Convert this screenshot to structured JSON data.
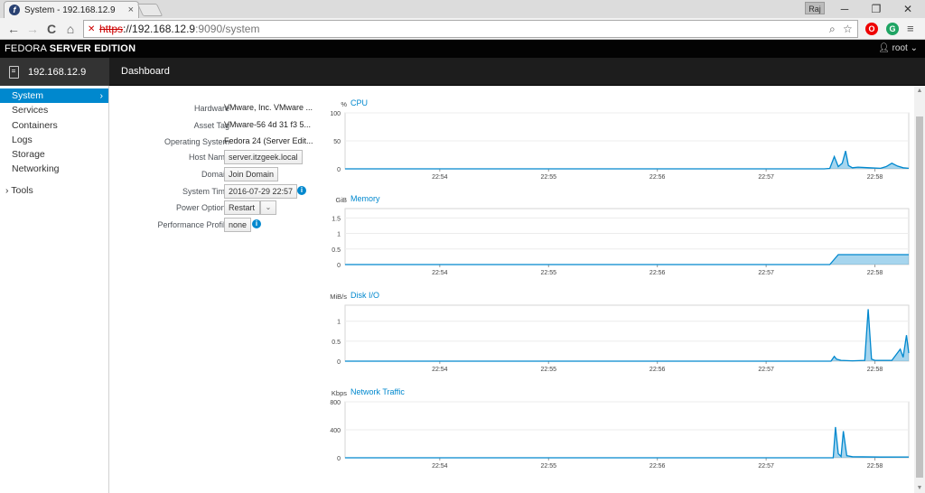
{
  "browser": {
    "tab_title": "System - 192.168.12.9",
    "tab_close": "×",
    "user_badge": "Raj",
    "url_scheme": "https",
    "url_host": "://192.168.12.9",
    "url_path": ":9090/system",
    "window_controls": {
      "minimize": "─",
      "restore": "❐",
      "close": "✕"
    },
    "nav": {
      "back": "←",
      "forward": "→",
      "reload": "C",
      "home": "⌂"
    }
  },
  "header": {
    "brand_light": "FEDORA",
    "brand_bold": "SERVER EDITION",
    "user": "root",
    "host": "192.168.12.9",
    "dashboard": "Dashboard"
  },
  "sidebar": {
    "items": [
      {
        "label": "System",
        "active": true
      },
      {
        "label": "Services"
      },
      {
        "label": "Containers"
      },
      {
        "label": "Logs"
      },
      {
        "label": "Storage"
      },
      {
        "label": "Networking"
      }
    ],
    "tools": "Tools"
  },
  "system_info": {
    "hardware_label": "Hardware",
    "hardware_value": "VMware, Inc. VMware ...",
    "asset_tag_label": "Asset Tag",
    "asset_tag_value": "VMware-56 4d 31 f3 5...",
    "os_label": "Operating System",
    "os_value": "Fedora 24 (Server Edit...",
    "hostname_label": "Host Name",
    "hostname_value": "server.itzgeek.local",
    "domain_label": "Domain",
    "domain_button": "Join Domain",
    "time_label": "System Time",
    "time_value": "2016-07-29 22:57",
    "power_label": "Power Options",
    "power_button": "Restart",
    "profile_label": "Performance Profile",
    "profile_value": "none"
  },
  "chart_data": [
    {
      "type": "area",
      "title": "CPU",
      "ylabel": "%",
      "yticks": [
        "100",
        "50",
        "0"
      ],
      "ylim": [
        0,
        100
      ],
      "x": [
        "22:54",
        "22:55",
        "22:56",
        "22:57",
        "22:58"
      ],
      "series": [
        {
          "points": [
            [
              0,
              0
            ],
            [
              0.85,
              0
            ],
            [
              0.86,
              0.8
            ],
            [
              0.868,
              22
            ],
            [
              0.875,
              4
            ],
            [
              0.882,
              10
            ],
            [
              0.888,
              32
            ],
            [
              0.893,
              6
            ],
            [
              0.9,
              2
            ],
            [
              0.91,
              3
            ],
            [
              0.93,
              2
            ],
            [
              0.95,
              1
            ],
            [
              0.96,
              4
            ],
            [
              0.97,
              10
            ],
            [
              0.98,
              5
            ],
            [
              0.99,
              2
            ],
            [
              1,
              1
            ]
          ]
        }
      ],
      "color": "#0088ce"
    },
    {
      "type": "area",
      "title": "Memory",
      "ylabel": "GiB",
      "yticks": [
        "1.5",
        "1",
        "0.5",
        "0"
      ],
      "ylim": [
        0,
        1.8
      ],
      "x": [
        "22:54",
        "22:55",
        "22:56",
        "22:57",
        "22:58"
      ],
      "series": [
        {
          "points": [
            [
              0,
              0
            ],
            [
              0.86,
              0
            ],
            [
              0.875,
              0.32
            ],
            [
              1,
              0.32
            ]
          ]
        }
      ],
      "color": "#0088ce"
    },
    {
      "type": "area",
      "title": "Disk I/O",
      "ylabel": "MiB/s",
      "yticks": [
        "1",
        "0.5",
        "0"
      ],
      "ylim": [
        0,
        1.4
      ],
      "x": [
        "22:54",
        "22:55",
        "22:56",
        "22:57",
        "22:58"
      ],
      "series": [
        {
          "points": [
            [
              0,
              0
            ],
            [
              0.862,
              0
            ],
            [
              0.868,
              0.12
            ],
            [
              0.872,
              0.05
            ],
            [
              0.88,
              0.02
            ],
            [
              0.9,
              0.01
            ],
            [
              0.922,
              0.02
            ],
            [
              0.928,
              1.3
            ],
            [
              0.934,
              0.05
            ],
            [
              0.94,
              0.02
            ],
            [
              0.97,
              0.02
            ],
            [
              0.985,
              0.3
            ],
            [
              0.99,
              0.1
            ],
            [
              0.996,
              0.65
            ],
            [
              1,
              0.2
            ]
          ]
        }
      ],
      "color": "#0088ce"
    },
    {
      "type": "area",
      "title": "Network Traffic",
      "ylabel": "Kbps",
      "yticks": [
        "800",
        "400",
        "0"
      ],
      "ylim": [
        0,
        800
      ],
      "x": [
        "22:54",
        "22:55",
        "22:56",
        "22:57",
        "22:58"
      ],
      "series": [
        {
          "points": [
            [
              0,
              0
            ],
            [
              0.866,
              0
            ],
            [
              0.87,
              440
            ],
            [
              0.875,
              60
            ],
            [
              0.88,
              20
            ],
            [
              0.884,
              380
            ],
            [
              0.89,
              30
            ],
            [
              0.9,
              15
            ],
            [
              0.95,
              10
            ],
            [
              1,
              12
            ]
          ]
        }
      ],
      "color": "#0088ce"
    }
  ]
}
